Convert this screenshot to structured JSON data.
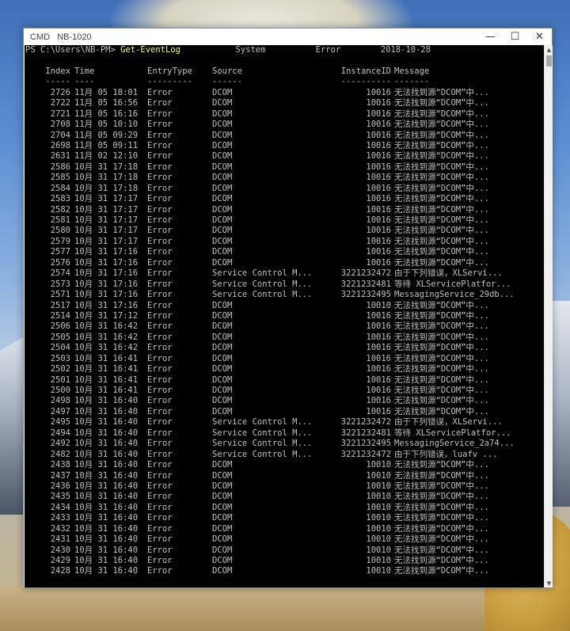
{
  "window": {
    "title": "CMD   NB-1020",
    "minimize_glyph": "—",
    "maximize_glyph": "☐",
    "close_glyph": "✕"
  },
  "console": {
    "prompt": "PS C:\\Users\\NB-PM> ",
    "command": "Get-EventLog",
    "arguments": "           System          Error        2018-10-28",
    "headers": {
      "index": "Index",
      "time": "Time",
      "entry_type": "EntryType",
      "source": "Source",
      "instance_id": "InstanceID",
      "message": "Message"
    },
    "separators": {
      "index": "-----",
      "time": "----",
      "entry_type": "---------",
      "source": "------",
      "instance_id": "----------",
      "message": "-------"
    },
    "rows": [
      {
        "index": "2726",
        "time": "11月 05 18:01",
        "type": "Error",
        "source": "DCOM",
        "iid": "10016",
        "msg": "无法找到源“DCOM”中..."
      },
      {
        "index": "2722",
        "time": "11月 05 16:56",
        "type": "Error",
        "source": "DCOM",
        "iid": "10016",
        "msg": "无法找到源“DCOM”中..."
      },
      {
        "index": "2721",
        "time": "11月 05 16:16",
        "type": "Error",
        "source": "DCOM",
        "iid": "10016",
        "msg": "无法找到源“DCOM”中..."
      },
      {
        "index": "2708",
        "time": "11月 05 10:10",
        "type": "Error",
        "source": "DCOM",
        "iid": "10016",
        "msg": "无法找到源“DCOM”中..."
      },
      {
        "index": "2704",
        "time": "11月 05 09:29",
        "type": "Error",
        "source": "DCOM",
        "iid": "10016",
        "msg": "无法找到源“DCOM”中..."
      },
      {
        "index": "2698",
        "time": "11月 05 09:11",
        "type": "Error",
        "source": "DCOM",
        "iid": "10016",
        "msg": "无法找到源“DCOM”中..."
      },
      {
        "index": "2631",
        "time": "11月 02 12:10",
        "type": "Error",
        "source": "DCOM",
        "iid": "10016",
        "msg": "无法找到源“DCOM”中..."
      },
      {
        "index": "2586",
        "time": "10月 31 17:18",
        "type": "Error",
        "source": "DCOM",
        "iid": "10016",
        "msg": "无法找到源“DCOM”中..."
      },
      {
        "index": "2585",
        "time": "10月 31 17:18",
        "type": "Error",
        "source": "DCOM",
        "iid": "10016",
        "msg": "无法找到源“DCOM”中..."
      },
      {
        "index": "2584",
        "time": "10月 31 17:18",
        "type": "Error",
        "source": "DCOM",
        "iid": "10016",
        "msg": "无法找到源“DCOM”中..."
      },
      {
        "index": "2583",
        "time": "10月 31 17:17",
        "type": "Error",
        "source": "DCOM",
        "iid": "10016",
        "msg": "无法找到源“DCOM”中..."
      },
      {
        "index": "2582",
        "time": "10月 31 17:17",
        "type": "Error",
        "source": "DCOM",
        "iid": "10016",
        "msg": "无法找到源“DCOM”中..."
      },
      {
        "index": "2581",
        "time": "10月 31 17:17",
        "type": "Error",
        "source": "DCOM",
        "iid": "10016",
        "msg": "无法找到源“DCOM”中..."
      },
      {
        "index": "2580",
        "time": "10月 31 17:17",
        "type": "Error",
        "source": "DCOM",
        "iid": "10016",
        "msg": "无法找到源“DCOM”中..."
      },
      {
        "index": "2579",
        "time": "10月 31 17:17",
        "type": "Error",
        "source": "DCOM",
        "iid": "10016",
        "msg": "无法找到源“DCOM”中..."
      },
      {
        "index": "2577",
        "time": "10月 31 17:16",
        "type": "Error",
        "source": "DCOM",
        "iid": "10016",
        "msg": "无法找到源“DCOM”中..."
      },
      {
        "index": "2576",
        "time": "10月 31 17:16",
        "type": "Error",
        "source": "DCOM",
        "iid": "10016",
        "msg": "无法找到源“DCOM”中..."
      },
      {
        "index": "2574",
        "time": "10月 31 17:16",
        "type": "Error",
        "source": "Service Control M...",
        "iid": "3221232472",
        "msg": "由于下列错误，XLServi..."
      },
      {
        "index": "2573",
        "time": "10月 31 17:16",
        "type": "Error",
        "source": "Service Control M...",
        "iid": "3221232481",
        "msg": "等待 XLServicePlatfor..."
      },
      {
        "index": "2571",
        "time": "10月 31 17:16",
        "type": "Error",
        "source": "Service Control M...",
        "iid": "3221232495",
        "msg": "MessagingService_29db..."
      },
      {
        "index": "2517",
        "time": "10月 31 17:16",
        "type": "Error",
        "source": "DCOM",
        "iid": "10010",
        "msg": "无法找到源“DCOM”中..."
      },
      {
        "index": "2514",
        "time": "10月 31 17:12",
        "type": "Error",
        "source": "DCOM",
        "iid": "10016",
        "msg": "无法找到源“DCOM”中..."
      },
      {
        "index": "2506",
        "time": "10月 31 16:42",
        "type": "Error",
        "source": "DCOM",
        "iid": "10016",
        "msg": "无法找到源“DCOM”中..."
      },
      {
        "index": "2505",
        "time": "10月 31 16:42",
        "type": "Error",
        "source": "DCOM",
        "iid": "10016",
        "msg": "无法找到源“DCOM”中..."
      },
      {
        "index": "2504",
        "time": "10月 31 16:42",
        "type": "Error",
        "source": "DCOM",
        "iid": "10016",
        "msg": "无法找到源“DCOM”中..."
      },
      {
        "index": "2503",
        "time": "10月 31 16:41",
        "type": "Error",
        "source": "DCOM",
        "iid": "10016",
        "msg": "无法找到源“DCOM”中..."
      },
      {
        "index": "2502",
        "time": "10月 31 16:41",
        "type": "Error",
        "source": "DCOM",
        "iid": "10016",
        "msg": "无法找到源“DCOM”中..."
      },
      {
        "index": "2501",
        "time": "10月 31 16:41",
        "type": "Error",
        "source": "DCOM",
        "iid": "10016",
        "msg": "无法找到源“DCOM”中..."
      },
      {
        "index": "2500",
        "time": "10月 31 16:41",
        "type": "Error",
        "source": "DCOM",
        "iid": "10016",
        "msg": "无法找到源“DCOM”中..."
      },
      {
        "index": "2498",
        "time": "10月 31 16:40",
        "type": "Error",
        "source": "DCOM",
        "iid": "10016",
        "msg": "无法找到源“DCOM”中..."
      },
      {
        "index": "2497",
        "time": "10月 31 16:40",
        "type": "Error",
        "source": "DCOM",
        "iid": "10016",
        "msg": "无法找到源“DCOM”中..."
      },
      {
        "index": "2495",
        "time": "10月 31 16:40",
        "type": "Error",
        "source": "Service Control M...",
        "iid": "3221232472",
        "msg": "由于下列错误，XLServi..."
      },
      {
        "index": "2494",
        "time": "10月 31 16:40",
        "type": "Error",
        "source": "Service Control M...",
        "iid": "3221232481",
        "msg": "等待 XLServicePlatfor..."
      },
      {
        "index": "2492",
        "time": "10月 31 16:40",
        "type": "Error",
        "source": "Service Control M...",
        "iid": "3221232495",
        "msg": "MessagingService_2a74..."
      },
      {
        "index": "2482",
        "time": "10月 31 16:40",
        "type": "Error",
        "source": "Service Control M...",
        "iid": "3221232472",
        "msg": "由于下列错误，luafv ..."
      },
      {
        "index": "2438",
        "time": "10月 31 16:40",
        "type": "Error",
        "source": "DCOM",
        "iid": "10010",
        "msg": "无法找到源“DCOM”中..."
      },
      {
        "index": "2437",
        "time": "10月 31 16:40",
        "type": "Error",
        "source": "DCOM",
        "iid": "10010",
        "msg": "无法找到源“DCOM”中..."
      },
      {
        "index": "2436",
        "time": "10月 31 16:40",
        "type": "Error",
        "source": "DCOM",
        "iid": "10010",
        "msg": "无法找到源“DCOM”中..."
      },
      {
        "index": "2435",
        "time": "10月 31 16:40",
        "type": "Error",
        "source": "DCOM",
        "iid": "10010",
        "msg": "无法找到源“DCOM”中..."
      },
      {
        "index": "2434",
        "time": "10月 31 16:40",
        "type": "Error",
        "source": "DCOM",
        "iid": "10010",
        "msg": "无法找到源“DCOM”中..."
      },
      {
        "index": "2433",
        "time": "10月 31 16:40",
        "type": "Error",
        "source": "DCOM",
        "iid": "10010",
        "msg": "无法找到源“DCOM”中..."
      },
      {
        "index": "2432",
        "time": "10月 31 16:40",
        "type": "Error",
        "source": "DCOM",
        "iid": "10010",
        "msg": "无法找到源“DCOM”中..."
      },
      {
        "index": "2431",
        "time": "10月 31 16:40",
        "type": "Error",
        "source": "DCOM",
        "iid": "10010",
        "msg": "无法找到源“DCOM”中..."
      },
      {
        "index": "2430",
        "time": "10月 31 16:40",
        "type": "Error",
        "source": "DCOM",
        "iid": "10010",
        "msg": "无法找到源“DCOM”中..."
      },
      {
        "index": "2429",
        "time": "10月 31 16:40",
        "type": "Error",
        "source": "DCOM",
        "iid": "10010",
        "msg": "无法找到源“DCOM”中..."
      },
      {
        "index": "2428",
        "time": "10月 31 16:40",
        "type": "Error",
        "source": "DCOM",
        "iid": "10010",
        "msg": "无法找到源“DCOM”中..."
      }
    ]
  }
}
